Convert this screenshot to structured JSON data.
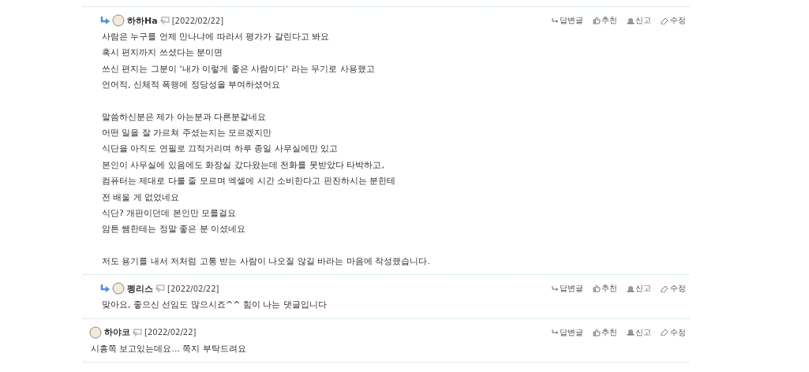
{
  "comments": [
    {
      "reply": true,
      "author": "하하Ha",
      "date": "[2022/02/22]",
      "paragraphs": [
        [
          "사람은 누구를 언제 만나냐에 따라서 평가가 갈린다고 봐요",
          "혹시 편지까지 쓰셨다는 분이면",
          "쓰신 편지는 그분이 '내가 이렇게 좋은 사람이다' 라는 무기로 사용했고",
          "언어적, 신체적 폭행에 정당성을 부여하셨어요"
        ],
        [
          "말씀하신분은 제가 아는분과 다른분같네요",
          "어떤 일을 잘 가르쳐 주셨는지는 모르겠지만",
          "식단을 아직도 연필로 끄적거리며 하루 종일 사무실에만 있고",
          "본인이 사무실에 있음에도 화장실 갔다왔는데 전화를 못받았다 타박하고,",
          "컴퓨터는 제대로 다룰 줄 모르며 엑셀에 시간 소비한다고 핀잔하시는 분한테",
          "전 배울 게 없었네요",
          "식단? 개판이던데 본인만 모를걸요",
          "암튼 쌤한테는 정말 좋은 분 이셨네요"
        ],
        [
          "저도 용기를 내서 저처럼 고통 받는 사람이 나오질 않길 바라는 마음에 작성했습니다."
        ]
      ],
      "actions": [
        {
          "kind": "reply",
          "label": "답변글"
        },
        {
          "kind": "like",
          "label": "추천"
        },
        {
          "kind": "report",
          "label": "신고"
        },
        {
          "kind": "edit",
          "label": "수정"
        }
      ]
    },
    {
      "reply": true,
      "author": "펭리스",
      "date": "[2022/02/22]",
      "paragraphs": [
        [
          "맞아요, 좋으신 선임도 많으시죠^^ 힘이 나는 댓글입니다"
        ]
      ],
      "actions": [
        {
          "kind": "reply",
          "label": "답변글"
        },
        {
          "kind": "like",
          "label": "추천"
        },
        {
          "kind": "report",
          "label": "신고"
        },
        {
          "kind": "edit",
          "label": "수정"
        }
      ]
    },
    {
      "reply": false,
      "author": "하야코",
      "date": "[2022/02/22]",
      "paragraphs": [
        [
          "시흥쪽 보고있는데요... 쪽지 부탁드려요"
        ]
      ],
      "actions": [
        {
          "kind": "reply",
          "label": "답변글"
        },
        {
          "kind": "like",
          "label": "추천"
        },
        {
          "kind": "report",
          "label": "신고"
        },
        {
          "kind": "edit",
          "label": "수정"
        }
      ]
    }
  ]
}
